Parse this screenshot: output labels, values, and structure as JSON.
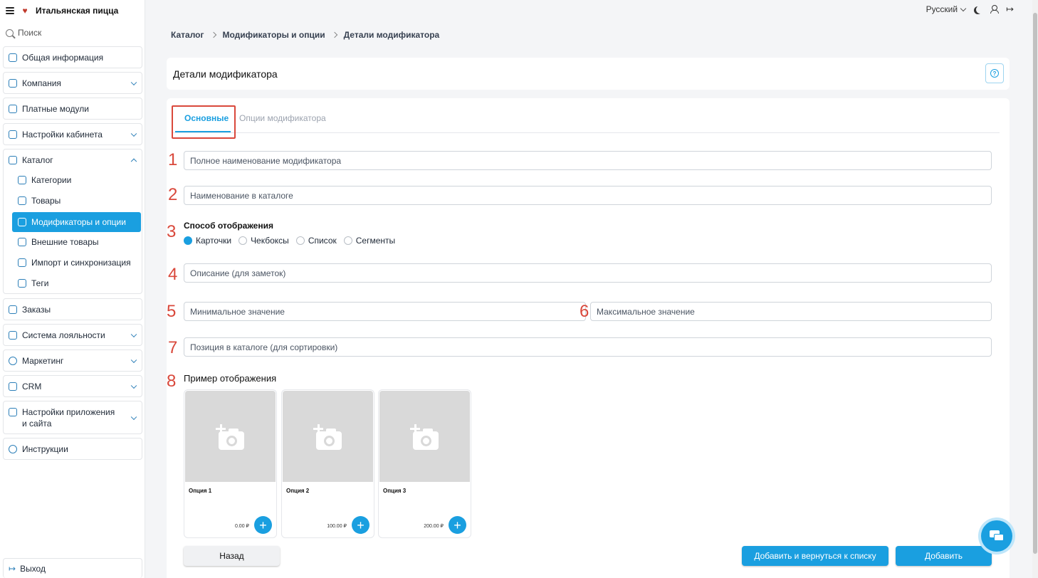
{
  "app": {
    "brand": "Итальянская пицца",
    "search_label": "Поиск",
    "language": "Русский"
  },
  "sidebar": {
    "items": [
      {
        "label": "Общая информация",
        "icon": "document-icon"
      },
      {
        "label": "Компания",
        "icon": "bank-icon",
        "expandable": true
      },
      {
        "label": "Платные модули",
        "icon": "coins-icon"
      },
      {
        "label": "Настройки кабинета",
        "icon": "settings-icon",
        "expandable": true
      },
      {
        "label": "Каталог",
        "icon": "catalog-icon",
        "expanded": true
      },
      {
        "label": "Заказы",
        "icon": "cloche-icon"
      },
      {
        "label": "Система лояльности",
        "icon": "loyalty-icon",
        "expandable": true
      },
      {
        "label": "Маркетинг",
        "icon": "megaphone-icon",
        "expandable": true
      },
      {
        "label": "CRM",
        "icon": "crm-icon",
        "expandable": true
      },
      {
        "label": "Настройки приложения и сайта",
        "icon": "app-settings-icon",
        "expandable": true
      },
      {
        "label": "Инструкции",
        "icon": "question-icon"
      }
    ],
    "catalog_sub": [
      {
        "label": "Категории",
        "icon": "edit-icon"
      },
      {
        "label": "Товары",
        "icon": "products-icon"
      },
      {
        "label": "Модификаторы и опции",
        "icon": "grid-icon",
        "active": true
      },
      {
        "label": "Внешние товары",
        "icon": "fork-icon"
      },
      {
        "label": "Импорт и синхронизация",
        "icon": "sync-icon"
      },
      {
        "label": "Теги",
        "icon": "tag-icon"
      }
    ],
    "logout": "Выход"
  },
  "breadcrumb": [
    "Каталог",
    "Модификаторы и опции",
    "Детали модификатора"
  ],
  "page": {
    "title": "Детали модификатора"
  },
  "tabs": [
    {
      "label": "Основные",
      "active": true
    },
    {
      "label": "Опции модификатора",
      "active": false
    }
  ],
  "form": {
    "full_name_placeholder": "Полное наименование модификатора",
    "catalog_name_placeholder": "Наименование в каталоге",
    "display_mode_label": "Способ отображения",
    "display_modes": [
      {
        "label": "Карточки",
        "selected": true
      },
      {
        "label": "Чекбоксы",
        "selected": false
      },
      {
        "label": "Список",
        "selected": false
      },
      {
        "label": "Сегменты",
        "selected": false
      }
    ],
    "description_placeholder": "Описание (для заметок)",
    "min_placeholder": "Минимальное значение",
    "max_placeholder": "Максимальное значение",
    "position_placeholder": "Позиция в каталоге (для сортировки)",
    "example_label": "Пример отображения"
  },
  "annotations": [
    "1",
    "2",
    "3",
    "4",
    "5",
    "6",
    "7",
    "8"
  ],
  "preview_cards": [
    {
      "title": "Опция 1",
      "price": "0.00 ₽"
    },
    {
      "title": "Опция 2",
      "price": "100.00 ₽"
    },
    {
      "title": "Опция 3",
      "price": "200.00 ₽"
    }
  ],
  "buttons": {
    "back": "Назад",
    "add_and_return": "Добавить и вернуться к списку",
    "add": "Добавить"
  },
  "colors": {
    "accent": "#1a9fe0",
    "annotation": "#d9483b"
  }
}
